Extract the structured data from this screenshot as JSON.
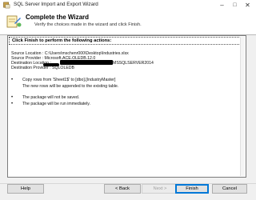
{
  "window": {
    "title": "SQL Server Import and Export Wizard"
  },
  "header": {
    "title": "Complete the Wizard",
    "subtitle": "Verify the choices made in the wizard and click Finish."
  },
  "panel": {
    "heading": "Click Finish to perform the following actions:",
    "source_location": "Source Location : C:\\Users\\mschenr000\\Desktop\\Industries.xlsx",
    "source_provider": "Source Provider : Microsoft.ACE.OLEDB.12.0",
    "destination_location_prefix": "Destination Location :",
    "destination_location_suffix": "MSSQLSERVER2014",
    "destination_provider": "Destination Provider : SQLOLEDB",
    "copy_rows": "Copy rows from 'Sheet1$' to [dbo].[IndustryMaster]",
    "append_note": "The new rows will be appended to the existing table.",
    "not_saved": "The package will not be saved.",
    "run_now": "The package will be run immediately."
  },
  "buttons": {
    "help": "Help",
    "back": "< Back",
    "next": "Next >",
    "finish": "Finish",
    "cancel": "Cancel"
  }
}
